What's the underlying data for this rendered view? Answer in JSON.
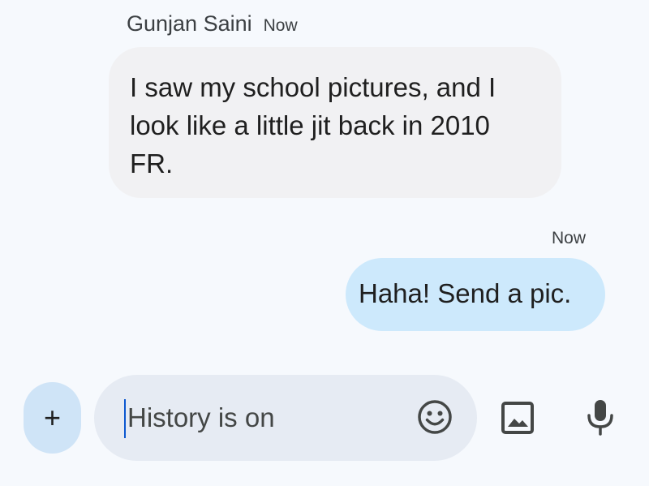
{
  "incoming": {
    "sender": "Gunjan Saini",
    "time": "Now",
    "lines": [
      "I saw my school pictures, and I",
      "look like a little jit back in 2010",
      "FR."
    ]
  },
  "outgoing": {
    "time": "Now",
    "text": "Haha! Send a pic."
  },
  "composer": {
    "add_label": "+",
    "placeholder": "History is on",
    "icons": [
      "plus-icon",
      "emoji-icon",
      "image-icon",
      "mic-icon"
    ]
  },
  "colors": {
    "background": "#f6f9fd",
    "incoming_bubble": "#f1f1f3",
    "outgoing_bubble": "#cde9fc",
    "input_pill": "#e6ebf3",
    "add_button": "#cfe4f7",
    "caret": "#0b57d0"
  }
}
